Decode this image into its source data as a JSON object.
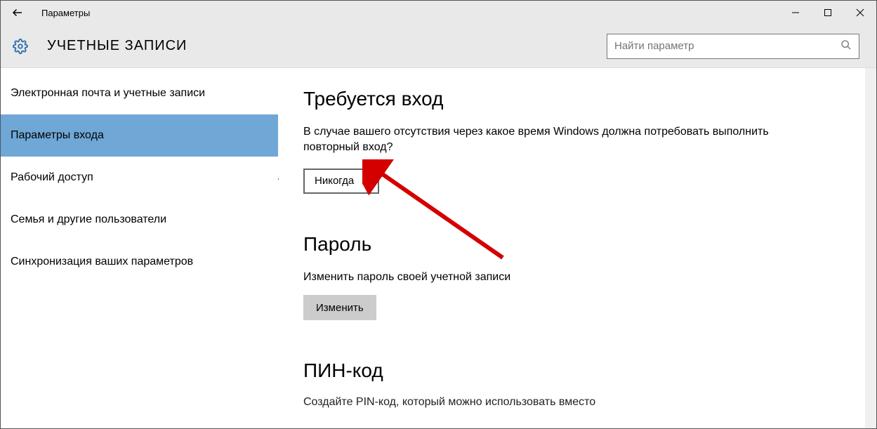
{
  "titlebar": {
    "title": "Параметры"
  },
  "header": {
    "page_title": "УЧЕТНЫЕ ЗАПИСИ",
    "search_placeholder": "Найти параметр"
  },
  "sidebar": {
    "items": [
      {
        "label": "Электронная почта и учетные записи"
      },
      {
        "label": "Параметры входа"
      },
      {
        "label": "Рабочий доступ"
      },
      {
        "label": "Семья и другие пользователи"
      },
      {
        "label": "Синхронизация ваших параметров"
      }
    ],
    "selected_index": 1
  },
  "content": {
    "signin_required": {
      "heading": "Требуется вход",
      "description": "В случае вашего отсутствия через какое время Windows должна потребовать выполнить повторный вход?",
      "combo_value": "Никогда"
    },
    "password": {
      "heading": "Пароль",
      "description": "Изменить пароль своей учетной записи",
      "button": "Изменить"
    },
    "pin": {
      "heading": "ПИН-код",
      "truncated": "Создайте PIN-код, который можно использовать вместо"
    }
  }
}
